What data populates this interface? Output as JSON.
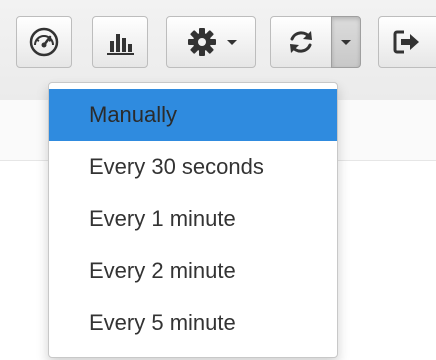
{
  "toolbar": {
    "buttons": [
      {
        "name": "dashboard",
        "icon": "speedometer-icon"
      },
      {
        "name": "statistics",
        "icon": "bar-chart-icon"
      },
      {
        "name": "settings",
        "icon": "gear-icon",
        "has_caret": true
      },
      {
        "name": "refresh",
        "icon": "refresh-icon"
      },
      {
        "name": "logout",
        "icon": "sign-out-icon"
      }
    ]
  },
  "refresh_menu": {
    "items": [
      {
        "label": "Manually",
        "active": true
      },
      {
        "label": "Every 30 seconds",
        "active": false
      },
      {
        "label": "Every 1 minute",
        "active": false
      },
      {
        "label": "Every 2 minute",
        "active": false
      },
      {
        "label": "Every 5 minute",
        "active": false
      }
    ]
  },
  "colors": {
    "active_item_bg": "#2f8bdf",
    "icon": "#333333",
    "text": "#333333"
  }
}
